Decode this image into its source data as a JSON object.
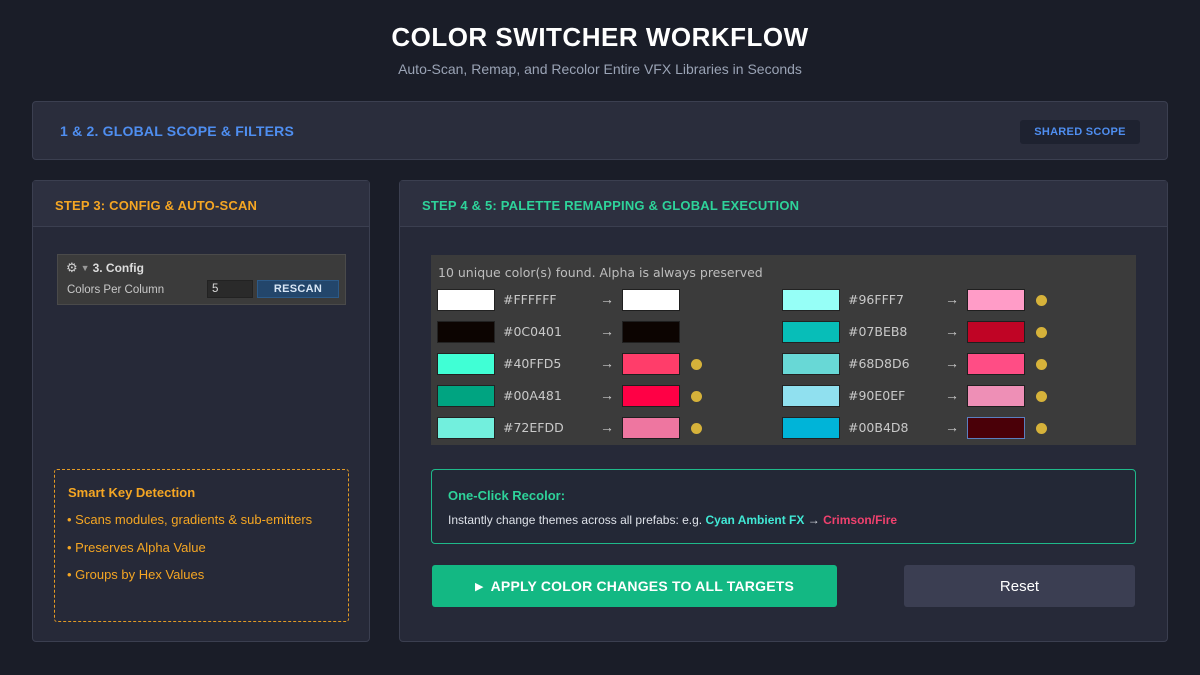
{
  "header": {
    "title": "COLOR SWITCHER WORKFLOW",
    "subtitle": "Auto-Scan, Remap, and Recolor Entire VFX Libraries in Seconds"
  },
  "scope": {
    "title": "1 & 2. GLOBAL SCOPE & FILTERS",
    "badge": "SHARED SCOPE"
  },
  "step3": {
    "title": "STEP 3: CONFIG & AUTO-SCAN",
    "config": {
      "header_label": "3. Config",
      "colors_per_column_label": "Colors Per Column",
      "colors_per_column_value": "5",
      "rescan_label": "RESCAN"
    },
    "smart": {
      "title": "Smart Key Detection",
      "items": [
        "• Scans modules, gradients & sub-emitters",
        "• Preserves Alpha Value",
        "• Groups by Hex Values"
      ]
    }
  },
  "step45": {
    "title": "STEP 4 & 5: PALETTE REMAPPING & GLOBAL EXECUTION",
    "palette": {
      "summary": "10 unique color(s) found. Alpha is always preserved",
      "arrow": "→",
      "left": [
        {
          "hex": "#FFFFFF",
          "from": "#FFFFFF",
          "to": "#FFFFFF",
          "changed": false
        },
        {
          "hex": "#0C0401",
          "from": "#0C0401",
          "to": "#0C0401",
          "changed": false
        },
        {
          "hex": "#40FFD5",
          "from": "#40FFD5",
          "to": "#FF3D6A",
          "changed": true
        },
        {
          "hex": "#00A481",
          "from": "#00A481",
          "to": "#FF0045",
          "changed": true
        },
        {
          "hex": "#72EFDD",
          "from": "#72EFDD",
          "to": "#EE76A0",
          "changed": true
        }
      ],
      "right": [
        {
          "hex": "#96FFF7",
          "from": "#96FFF7",
          "to": "#FF9CC7",
          "changed": true
        },
        {
          "hex": "#07BEB8",
          "from": "#07BEB8",
          "to": "#C00425",
          "changed": true
        },
        {
          "hex": "#68D8D6",
          "from": "#68D8D6",
          "to": "#FF4D85",
          "changed": true
        },
        {
          "hex": "#90E0EF",
          "from": "#90E0EF",
          "to": "#EE8FB6",
          "changed": true
        },
        {
          "hex": "#00B4D8",
          "from": "#00B4D8",
          "to": "#4A0008",
          "changed": true
        }
      ]
    },
    "recolor": {
      "title": "One-Click Recolor:",
      "text_prefix": "Instantly change themes across all prefabs:  e.g. ",
      "from_theme": "Cyan Ambient FX",
      "arrow": " → ",
      "to_theme": "Crimson/Fire"
    },
    "apply_label": "APPLY COLOR CHANGES TO ALL TARGETS",
    "reset_label": "Reset"
  },
  "colors": {
    "accent_blue": "#4F8EF0",
    "accent_orange": "#F5A623",
    "accent_green": "#13B883",
    "changed_dot": "#D6B23A"
  }
}
